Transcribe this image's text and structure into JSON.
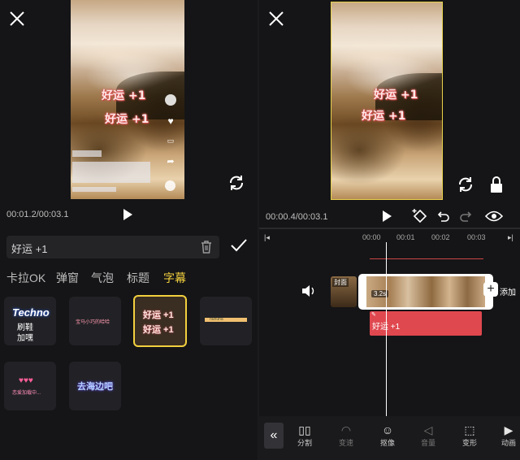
{
  "left": {
    "timecode": "00:01.2/00:03.1",
    "overlay_text_1": "好运 +1",
    "overlay_text_2": "好运 +1",
    "text_input_value": "好运 +1",
    "tabs": [
      {
        "label": "卡拉OK",
        "active": false
      },
      {
        "label": "弹窗",
        "active": false
      },
      {
        "label": "气泡",
        "active": false
      },
      {
        "label": "标题",
        "active": false
      },
      {
        "label": "字幕",
        "active": true
      }
    ],
    "tiles": [
      {
        "line1": "Techno",
        "line2": "刷鞋",
        "line3": "加嘿"
      },
      {
        "line1": "宝马小巧的哈哈"
      },
      {
        "line1": "好运 +1",
        "line2": "好运 +1"
      },
      {
        "line1": "nununa"
      },
      {
        "line1": "♥♥♥",
        "line2": "恋爱加载中..."
      },
      {
        "line1": "去海边吧"
      }
    ],
    "accent_color": "#f3d03e"
  },
  "right": {
    "timecode": "00:00.4/00:03.1",
    "overlay_text_1": "好运 +1",
    "overlay_text_2": "好运 +1",
    "ruler_marks": [
      "00:00",
      "00:01",
      "00:02",
      "00:03"
    ],
    "cover_label": "封面",
    "clip_duration": "3.2s",
    "add_label": "添加",
    "text_track_label": "好运 +1",
    "text_track_color": "#e0484f",
    "bottom_tools": [
      {
        "label": "分割",
        "icon": "split-icon"
      },
      {
        "label": "变速",
        "icon": "speed-icon"
      },
      {
        "label": "抠像",
        "icon": "cutout-icon"
      },
      {
        "label": "音量",
        "icon": "volume-icon"
      },
      {
        "label": "变形",
        "icon": "transform-icon"
      },
      {
        "label": "动画",
        "icon": "animation-icon"
      }
    ]
  }
}
